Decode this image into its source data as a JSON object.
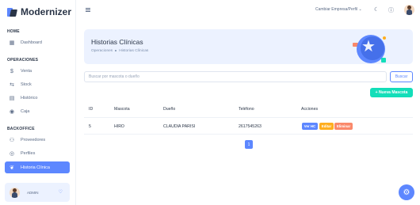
{
  "app": {
    "name": "Modernizer"
  },
  "sidebar": {
    "sections": {
      "home": "HOME",
      "operaciones": "OPERACIONES",
      "backoffice": "BACKOFFICE"
    },
    "items": [
      {
        "label": "Dashboard",
        "icon": "dashboard-icon"
      },
      {
        "label": "Venta",
        "icon": "currency-icon"
      },
      {
        "label": "Stock",
        "icon": "transfer-icon"
      },
      {
        "label": "Histórico",
        "icon": "history-icon"
      },
      {
        "label": "Caja",
        "icon": "cash-icon"
      },
      {
        "label": "Proveedores",
        "icon": "users-icon"
      },
      {
        "label": "Perfiles",
        "icon": "profile-icon"
      },
      {
        "label": "Historia Clínica",
        "icon": "pet-icon",
        "active": true
      }
    ],
    "profile": {
      "name": "ADMIN"
    }
  },
  "topbar": {
    "company_select": "Cambiar Empresa/Perfil ⌄"
  },
  "banner": {
    "title": "Historias Clínicas",
    "breadcrumb": [
      "Operaciones",
      "Historias Clínicas"
    ]
  },
  "search": {
    "placeholder": "Buscar por mascota o dueño",
    "value": "",
    "button": "Buscar"
  },
  "new_button": "+ Nueva Mascota",
  "table": {
    "headers": [
      "ID",
      "Mascota",
      "Dueño",
      "Teléfono",
      "Acciones"
    ],
    "rows": [
      {
        "id": "5",
        "mascota": "HIRO",
        "dueno": "CLAUDIA PARISI",
        "telefono": "2617545263"
      }
    ],
    "actions": [
      "Ver HC",
      "Editar",
      "Eliminar"
    ]
  },
  "pagination": {
    "current": "1"
  },
  "colors": {
    "primary": "#5d87ff",
    "success": "#13deb9",
    "warning": "#ffae1f",
    "danger": "#fa896b",
    "banner_bg": "#ecf2ff"
  }
}
